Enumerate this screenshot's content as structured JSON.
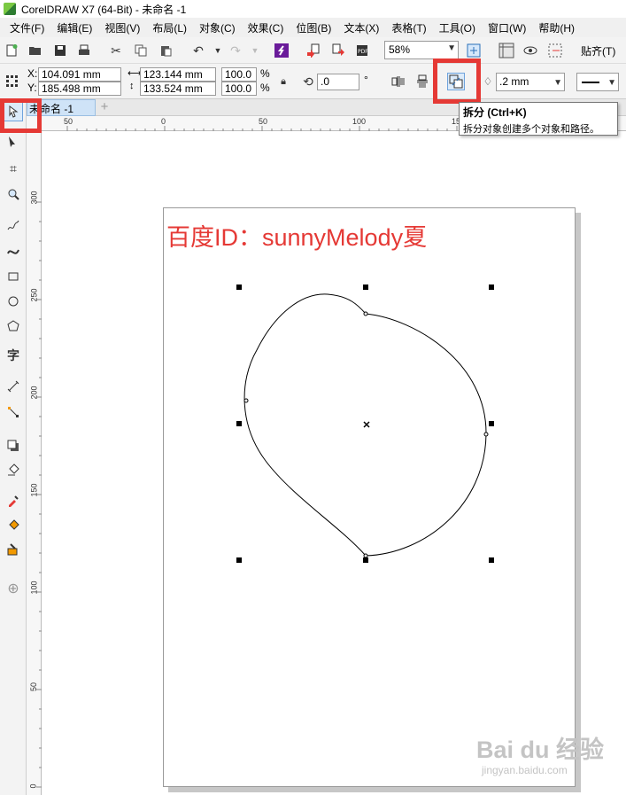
{
  "window": {
    "title": "CorelDRAW X7 (64-Bit) - 未命名 -1"
  },
  "menu": [
    "文件(F)",
    "编辑(E)",
    "视图(V)",
    "布局(L)",
    "对象(C)",
    "效果(C)",
    "位图(B)",
    "文本(X)",
    "表格(T)",
    "工具(O)",
    "窗口(W)",
    "帮助(H)"
  ],
  "toolbar": {
    "zoom": "58%",
    "paste_label": "贴齐(T)"
  },
  "property_bar": {
    "x_label": "X:",
    "y_label": "Y:",
    "x": "104.091 mm",
    "y": "185.498 mm",
    "width": "123.144 mm",
    "height": "133.524 mm",
    "scale_x": "100.0",
    "scale_y": "100.0",
    "percent": "%",
    "rotation": ".0",
    "degree": "°",
    "outline_width": ".2 mm"
  },
  "document": {
    "tab_label": "未命名 -1",
    "add_tab": "+"
  },
  "tooltip": {
    "title": "拆分 (Ctrl+K)",
    "description": "拆分对象创建多个对象和路径。"
  },
  "rulers": {
    "horizontal_ticks": [
      "50",
      "0",
      "50",
      "100",
      "15"
    ],
    "vertical_ticks": [
      "300",
      "250",
      "200",
      "150",
      "100",
      "50",
      "0"
    ]
  },
  "canvas_text": {
    "watermark_id": "百度ID：sunnyMelody夏"
  },
  "watermark": {
    "logo": "Bai du 经验",
    "url": "jingyan.baidu.com"
  },
  "icons": {
    "toolbar": [
      "new-document-icon",
      "open-icon",
      "save-icon",
      "print-icon",
      "cut-icon",
      "copy-icon",
      "paste-icon",
      "undo-icon",
      "redo-icon",
      "corel-connect-icon",
      "import-icon",
      "export-icon",
      "publish-pdf-icon",
      "zoom-dropdown-icon",
      "full-screen-icon",
      "rulers-icon",
      "wireframe-icon",
      "snap-icon"
    ],
    "tools": [
      "pick-tool-icon",
      "shape-tool-icon",
      "crop-tool-icon",
      "zoom-tool-icon",
      "freehand-tool-icon",
      "smart-drawing-icon",
      "rectangle-tool-icon",
      "ellipse-tool-icon",
      "polygon-tool-icon",
      "text-tool-icon",
      "parallel-dimension-icon",
      "connector-tool-icon",
      "drop-shadow-icon",
      "transparency-icon",
      "eyedropper-icon",
      "interactive-fill-icon",
      "smart-fill-icon",
      "add-tool-icon"
    ]
  },
  "colors": {
    "highlight": "#e53935",
    "selected_tab": "#cfe3f7"
  }
}
